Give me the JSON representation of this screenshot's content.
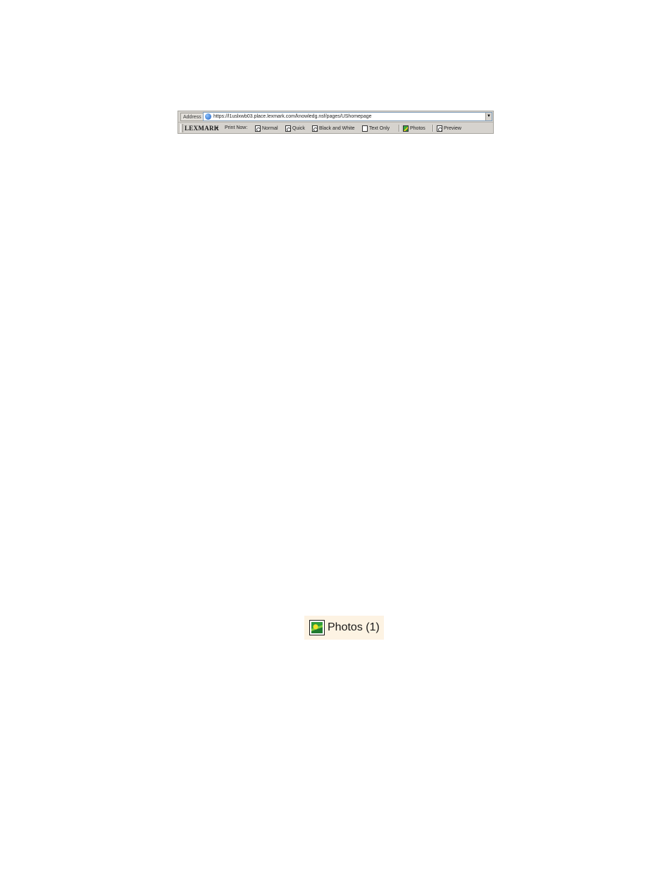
{
  "address_bar": {
    "label": "Address",
    "url": "https://l1uslxwb03.place.lexmark.com/knowledg.nsf/pages/UShomepage",
    "dropdown_glyph": "▼"
  },
  "print_toolbar": {
    "brand": "LEXMARK",
    "brand_menu_glyph": "▾",
    "print_now_label": "Print Now:",
    "buttons": [
      {
        "label": "Normal",
        "icon": "normal-print-icon"
      },
      {
        "label": "Quick",
        "icon": "quick-print-icon"
      },
      {
        "label": "Black and White",
        "icon": "black-white-print-icon"
      },
      {
        "label": "Text Only",
        "icon": "text-only-print-icon"
      },
      {
        "label": "Photos",
        "icon": "photos-print-icon"
      },
      {
        "label": "Preview",
        "icon": "preview-icon"
      }
    ]
  },
  "photos_badge": {
    "label": "Photos (1)",
    "icon": "photo-icon"
  }
}
